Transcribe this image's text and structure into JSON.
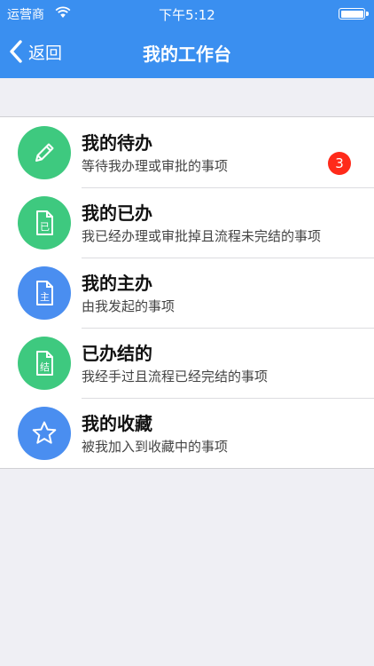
{
  "status_bar": {
    "carrier": "运营商",
    "time": "下午5:12"
  },
  "nav": {
    "back_label": "返回",
    "title": "我的工作台"
  },
  "colors": {
    "nav_background": "#3a8ff0",
    "green_icon": "#3ec97f",
    "blue_icon": "#4a8ef0",
    "badge": "#ff2a1a"
  },
  "items": [
    {
      "title": "我的待办",
      "subtitle": "等待我办理或审批的事项",
      "icon": "pencil-icon",
      "badge": "3"
    },
    {
      "title": "我的已办",
      "subtitle": "我已经办理或审批掉且流程未完结的事项",
      "icon": "document-done-icon"
    },
    {
      "title": "我的主办",
      "subtitle": "由我发起的事项",
      "icon": "document-host-icon"
    },
    {
      "title": "已办结的",
      "subtitle": "我经手过且流程已经完结的事项",
      "icon": "document-finished-icon"
    },
    {
      "title": "我的收藏",
      "subtitle": "被我加入到收藏中的事项",
      "icon": "star-icon"
    }
  ],
  "icon_glyphs": {
    "done": "已",
    "host": "主",
    "finished": "结"
  }
}
